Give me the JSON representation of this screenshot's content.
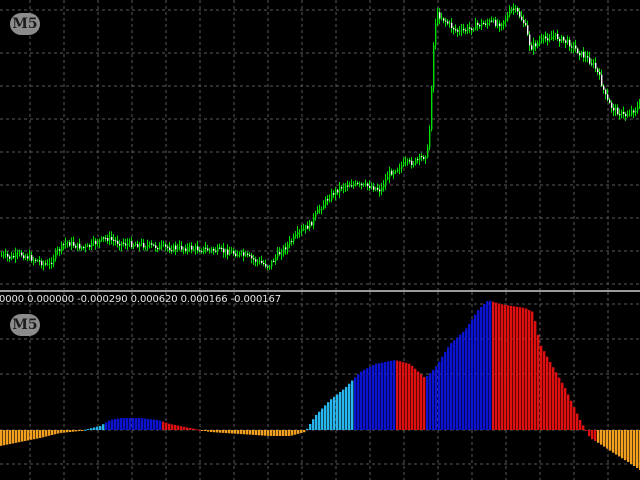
{
  "price_panel": {
    "timeframe_badge": "M5",
    "grid_color": "#5a5a5a",
    "candle_bull_color": "#00e000",
    "candle_bear_color": "#ffffff"
  },
  "oscillator_panel": {
    "timeframe_badge": "M5",
    "values_line": "0000 0.000000 -0.000290 0.000620 0.000166 -0.000167",
    "colors": {
      "strong_up": "#0a14d2",
      "weak_up": "#27b6ee",
      "strong_down": "#e01010",
      "weak_down": "#f3a020"
    }
  }
}
